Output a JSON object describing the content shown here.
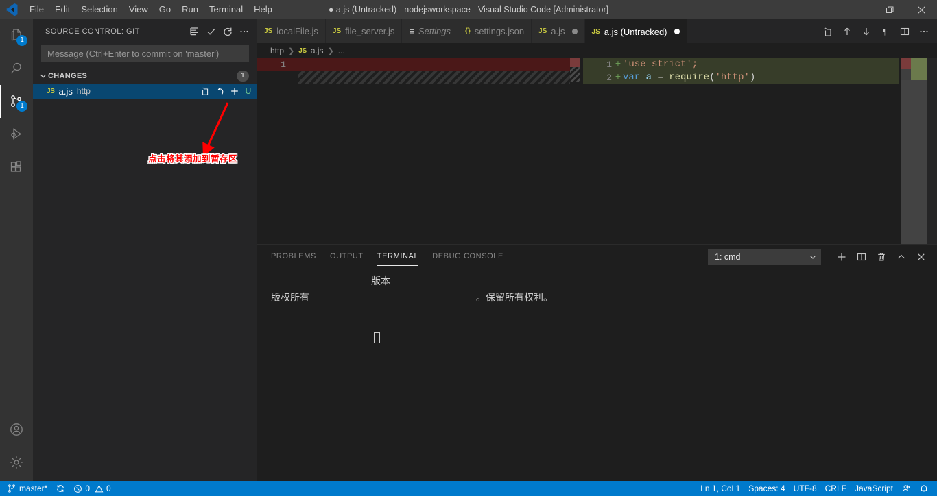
{
  "window": {
    "title": "● a.js (Untracked) - nodejsworkspace - Visual Studio Code [Administrator]",
    "minimize_label": "Minimize",
    "restore_label": "Restore",
    "close_label": "Close"
  },
  "menu": {
    "items": [
      {
        "label": "File"
      },
      {
        "label": "Edit"
      },
      {
        "label": "Selection"
      },
      {
        "label": "View"
      },
      {
        "label": "Go"
      },
      {
        "label": "Run"
      },
      {
        "label": "Terminal"
      },
      {
        "label": "Help"
      }
    ]
  },
  "activity_bar": {
    "items": [
      {
        "name": "explorer",
        "icon": "files-icon",
        "badge": "1",
        "active": false
      },
      {
        "name": "search",
        "icon": "search-icon",
        "badge": "",
        "active": false
      },
      {
        "name": "source-control",
        "icon": "source-control-icon",
        "badge": "1",
        "active": true
      },
      {
        "name": "run-and-debug",
        "icon": "debug-icon",
        "badge": "",
        "active": false
      },
      {
        "name": "extensions",
        "icon": "extensions-icon",
        "badge": "",
        "active": false
      }
    ],
    "bottom_items": [
      {
        "name": "accounts",
        "icon": "account-icon"
      },
      {
        "name": "manage",
        "icon": "gear-icon"
      }
    ]
  },
  "sidebar": {
    "title": "SOURCE CONTROL: GIT",
    "actions": [
      {
        "name": "view-as-tree",
        "icon": "list-icon"
      },
      {
        "name": "commit",
        "icon": "check-icon"
      },
      {
        "name": "refresh",
        "icon": "refresh-icon"
      },
      {
        "name": "more-actions",
        "icon": "ellipsis-icon"
      }
    ],
    "commit_input_placeholder": "Message (Ctrl+Enter to commit on 'master')",
    "commit_input_value": "",
    "changes": {
      "label": "CHANGES",
      "count": "1",
      "files": [
        {
          "icon": "js-file-icon",
          "icon_label": "JS",
          "name": "a.js",
          "path": "http",
          "status": "U",
          "actions": [
            {
              "name": "open-file",
              "icon": "open-file-icon"
            },
            {
              "name": "discard-changes",
              "icon": "discard-icon"
            },
            {
              "name": "stage-changes",
              "icon": "plus-icon"
            }
          ]
        }
      ]
    }
  },
  "annotation": {
    "text": "点击将其添加到暂存区",
    "color": "#ff0000"
  },
  "editor": {
    "tabs": [
      {
        "icon_label": "JS",
        "icon_color": "#cbcb41",
        "label": "localFile.js",
        "active": false,
        "italic": false,
        "dirty": false
      },
      {
        "icon_label": "JS",
        "icon_color": "#cbcb41",
        "label": "file_server.js",
        "active": false,
        "italic": false,
        "dirty": false
      },
      {
        "icon_label": "≡",
        "icon_color": "#9cdcfe",
        "label": "Settings",
        "active": false,
        "italic": true,
        "dirty": false
      },
      {
        "icon_label": "{}",
        "icon_color": "#cbcb41",
        "label": "settings.json",
        "active": false,
        "italic": false,
        "dirty": false
      },
      {
        "icon_label": "JS",
        "icon_color": "#cbcb41",
        "label": "a.js",
        "active": false,
        "italic": false,
        "dirty": true,
        "dirty_color": "#8a8a8a"
      },
      {
        "icon_label": "JS",
        "icon_color": "#cbcb41",
        "label": "a.js (Untracked)",
        "active": true,
        "italic": false,
        "dirty": true,
        "dirty_color": "#ffffff"
      }
    ],
    "tab_actions": [
      {
        "name": "open-changes",
        "icon": "compare-icon"
      },
      {
        "name": "previous-change",
        "icon": "arrow-up-icon"
      },
      {
        "name": "next-change",
        "icon": "arrow-down-icon"
      },
      {
        "name": "toggle-whitespace",
        "icon": "pilcrow-icon"
      },
      {
        "name": "split-editor",
        "icon": "split-editor-icon"
      },
      {
        "name": "more-actions",
        "icon": "ellipsis-icon"
      }
    ],
    "breadcrumb": [
      "http",
      "a.js",
      "..."
    ],
    "breadcrumb_icon_label": "JS",
    "diff": {
      "left": [
        {
          "line_no": "1",
          "sign": "—",
          "text": "",
          "type": "deleted"
        }
      ],
      "right": [
        {
          "line_no": "1",
          "sign": "+",
          "text": "'use strict';",
          "type": "added"
        },
        {
          "line_no": "2",
          "sign": "+",
          "text": "var a = require('http')",
          "type": "added"
        }
      ]
    }
  },
  "panel": {
    "tabs": [
      {
        "label": "PROBLEMS",
        "active": false
      },
      {
        "label": "OUTPUT",
        "active": false
      },
      {
        "label": "TERMINAL",
        "active": true
      },
      {
        "label": "DEBUG CONSOLE",
        "active": false
      }
    ],
    "terminal_select_value": "1: cmd",
    "actions": [
      {
        "name": "new-terminal",
        "icon": "plus-icon"
      },
      {
        "name": "split-terminal",
        "icon": "split-icon"
      },
      {
        "name": "kill-terminal",
        "icon": "trash-icon"
      },
      {
        "name": "maximize-panel",
        "icon": "chevron-up-icon"
      },
      {
        "name": "close-panel",
        "icon": "close-icon"
      }
    ],
    "terminal_lines": [
      {
        "indent": 10,
        "text": "版本"
      },
      {
        "indent": 1,
        "text": "版权所有",
        "suffix_indent": 24,
        "suffix": "。保留所有权利。"
      },
      {
        "indent": 10,
        "text": "",
        "cursor": true
      }
    ]
  },
  "status_bar": {
    "left": [
      {
        "name": "branch",
        "icon": "git-branch-icon",
        "label": "master*"
      },
      {
        "name": "sync",
        "icon": "sync-icon",
        "label": ""
      },
      {
        "name": "problems",
        "icon": "error-warning-icon",
        "label": "0  0",
        "errors": "0",
        "warnings": "0"
      }
    ],
    "right": [
      {
        "name": "cursor-position",
        "label": "Ln 1, Col 1"
      },
      {
        "name": "indentation",
        "label": "Spaces: 4"
      },
      {
        "name": "encoding",
        "label": "UTF-8"
      },
      {
        "name": "eol",
        "label": "CRLF"
      },
      {
        "name": "language-mode",
        "label": "JavaScript"
      },
      {
        "name": "feedback",
        "icon": "feedback-icon",
        "label": ""
      },
      {
        "name": "notifications",
        "icon": "bell-icon",
        "label": ""
      }
    ]
  },
  "colors": {
    "accent": "#007acc",
    "selection": "#094771",
    "editor_bg": "#1e1e1e",
    "sidebar_bg": "#252526",
    "added_bg": "#373d29",
    "deleted_bg": "#4b1818"
  }
}
